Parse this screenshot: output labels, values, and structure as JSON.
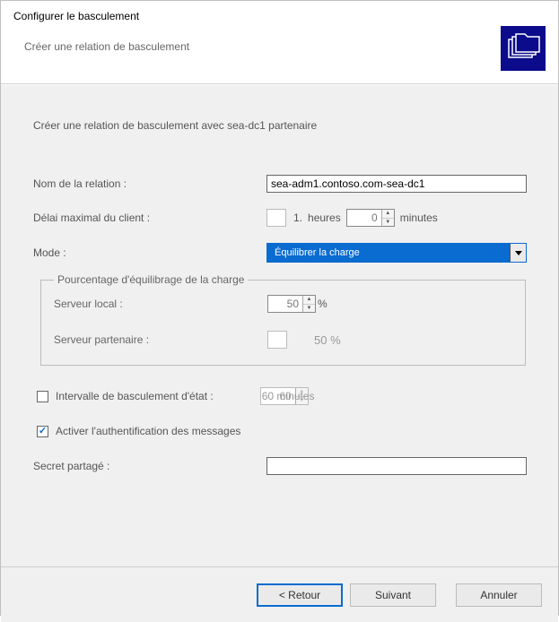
{
  "window": {
    "title": "Configurer le basculement",
    "subtitle": "Créer une relation de basculement"
  },
  "main": {
    "intro": "Créer une relation de basculement avec sea-dc1 partenaire",
    "relation_name_label": "Nom de la relation :",
    "relation_name_value": "sea-adm1.contoso.com-sea-dc1",
    "max_client_label": "Délai maximal du client :",
    "hours_value": "1",
    "hours_unit": "heures",
    "minutes_value": "0",
    "minutes_unit": "minutes",
    "mode_label": "Mode :",
    "mode_value": "Équilibrer la charge",
    "lb_group_legend": "Pourcentage d'équilibrage de la charge",
    "local_server_label": "Serveur local :",
    "local_server_value": "50",
    "local_server_suffix": "%",
    "partner_server_label": "Serveur partenaire :",
    "partner_server_value": "50 %",
    "state_switch_label": "Intervalle de basculement d'état :",
    "state_switch_value": "60",
    "state_switch_unit": "minutes",
    "auth_label": "Activer l'authentification des messages",
    "secret_label": "Secret partagé :",
    "secret_value": ""
  },
  "footer": {
    "back": "< Retour",
    "next": "Suivant",
    "cancel": "Annuler"
  }
}
